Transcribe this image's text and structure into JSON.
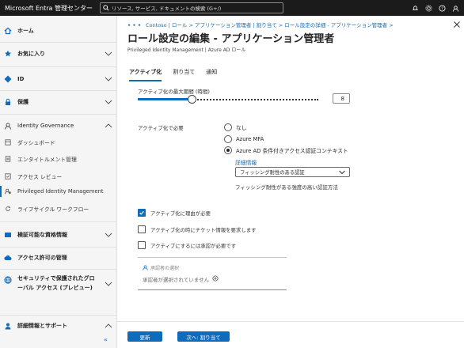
{
  "header": {
    "brand": "Microsoft Entra 管理センター",
    "search_placeholder": "リソース, サービス, ドキュメントの検索 (G+/)"
  },
  "sidebar": {
    "items": [
      {
        "label": "ホーム",
        "icon": "home-icon",
        "bold": true
      },
      {
        "label": "お気に入り",
        "icon": "star-icon",
        "bold": true
      },
      {
        "label": "ID",
        "icon": "diamond-icon",
        "bold": true
      },
      {
        "label": "保護",
        "icon": "lock-icon",
        "bold": true
      },
      {
        "label": "Identity Governance",
        "icon": "governance-icon",
        "bold": false
      }
    ],
    "sub_items": [
      {
        "label": "ダッシュボード"
      },
      {
        "label": "エンタイトルメント管理"
      },
      {
        "label": "アクセス レビュー"
      },
      {
        "label": "Privileged Identity Management",
        "selected": true
      },
      {
        "label": "ライフサイクル ワークフロー"
      }
    ],
    "lower_items": [
      {
        "label": "検証可能な資格情報"
      },
      {
        "label": "アクセス許可の管理"
      },
      {
        "label_line1": "セキュリティで保護されたグロ",
        "label_line2": "ーバル アクセス (プレビュー)"
      },
      {
        "label": "詳細情報とサポート"
      }
    ],
    "collapse_glyph": "«"
  },
  "main": {
    "breadcrumb": {
      "dots": "• • •",
      "text": "Contoso | ロール  >  アプリケーション管理者 | 割り当て  >  ロール設定の詳細 - アプリケーション管理者  >"
    },
    "title": "ロール設定の編集 - アプリケーション管理者",
    "more": "…",
    "subtitle": "Privileged Identity Management | Azure AD ロール",
    "tabs": [
      "アクティブ化",
      "割り当て",
      "通知"
    ],
    "max_duration_label": "アクティブ化の最大期間 (時間)",
    "max_duration_value": "8",
    "max_duration_level": 0.3,
    "require_label": "アクティブ化で必要",
    "radio_options": [
      {
        "label": "なし",
        "checked": false
      },
      {
        "label": "Azure MFA",
        "checked": false
      },
      {
        "label": "Azure AD 条件付きアクセス認証コンテキスト",
        "checked": true
      }
    ],
    "details_link": "詳細情報",
    "auth_context_value": "フィッシング耐性のある認証",
    "auth_context_note": "フィッシング耐性がある強度の高い認証方法",
    "checkboxes": [
      {
        "label": "アクティブ化に理由が必要",
        "checked": true
      },
      {
        "label": "アクティブ化の時にチケット情報を要求します",
        "checked": false
      },
      {
        "label": "アクティブにするには承認が必要です",
        "checked": false
      }
    ],
    "approver_header": "承認者の選択",
    "approver_empty": "承認者が選択されていません"
  },
  "footer": {
    "update_label": "更新",
    "next_label": "次へ: 割り当て"
  },
  "colors": {
    "accent": "#0f6cbd",
    "topbar": "#1b1b1b",
    "sidebar": "#f5f5f5"
  }
}
